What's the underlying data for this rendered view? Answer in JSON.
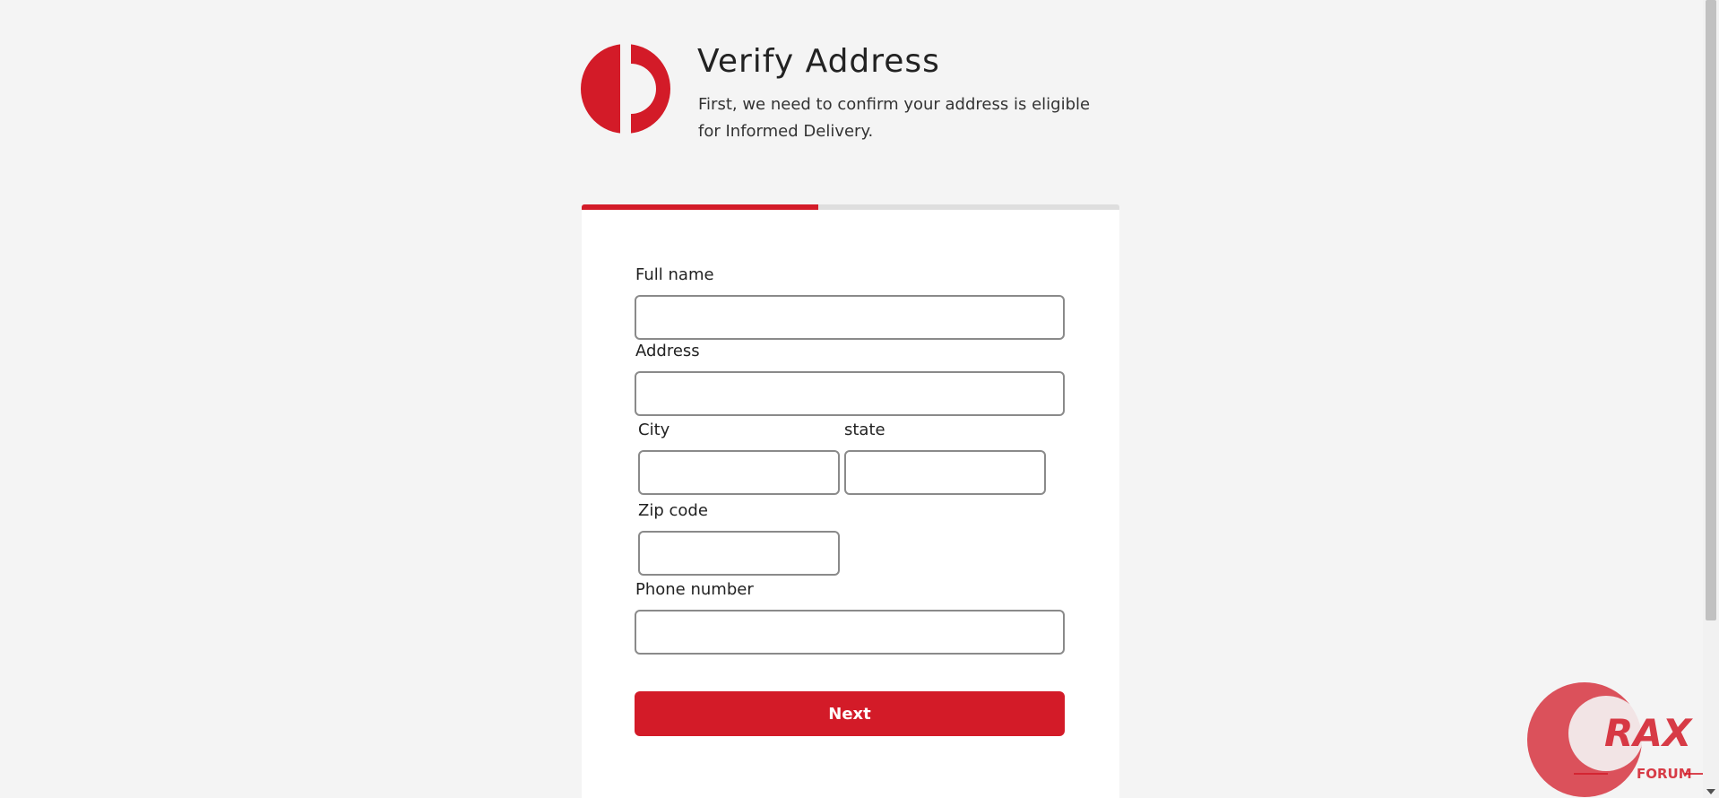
{
  "header": {
    "title": "Verify Address",
    "subtitle": "First, we need to confirm your address is eligible for Informed Delivery."
  },
  "progress": {
    "fraction": 0.44
  },
  "form": {
    "full_name": {
      "label": "Full name",
      "value": ""
    },
    "address": {
      "label": "Address",
      "value": ""
    },
    "city": {
      "label": "City",
      "value": ""
    },
    "state": {
      "label": "state",
      "value": ""
    },
    "zip": {
      "label": "Zip code",
      "value": ""
    },
    "phone": {
      "label": "Phone number",
      "value": ""
    },
    "next_label": "Next"
  },
  "watermark": {
    "brand": "RAX",
    "sub": "FORUM"
  },
  "colors": {
    "accent": "#d31b28",
    "background": "#f4f4f4",
    "card": "#ffffff",
    "track": "#dedede"
  },
  "icons": {
    "logo": "brand-logo-icon",
    "watermark": "crax-forum-watermark"
  }
}
